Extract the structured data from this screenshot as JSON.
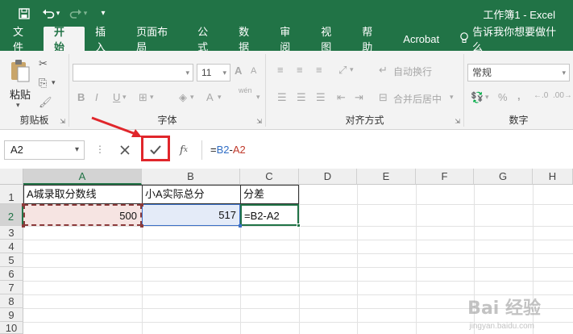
{
  "window": {
    "title": "工作簿1  -  Excel"
  },
  "qat": {
    "save_icon": "save-icon",
    "undo_icon": "undo-icon",
    "redo_icon": "redo-icon"
  },
  "tabs": [
    {
      "label": "文件"
    },
    {
      "label": "开始"
    },
    {
      "label": "插入"
    },
    {
      "label": "页面布局"
    },
    {
      "label": "公式"
    },
    {
      "label": "数据"
    },
    {
      "label": "审阅"
    },
    {
      "label": "视图"
    },
    {
      "label": "帮助"
    },
    {
      "label": "Acrobat"
    }
  ],
  "tell_me": "告诉我你想要做什么",
  "ribbon": {
    "clipboard": {
      "paste_label": "粘贴",
      "group_label": "剪贴板"
    },
    "font": {
      "font_size": "11",
      "group_label": "字体",
      "bold": "B",
      "italic": "I",
      "underline": "U",
      "font_color": "A",
      "size_up": "A",
      "size_down": "A",
      "wen": "wén"
    },
    "alignment": {
      "wrap_text": "自动换行",
      "merge_center": "合并后居中",
      "group_label": "对齐方式"
    },
    "number": {
      "format": "常规",
      "percent": "%",
      "comma": ",",
      "group_label": "数字"
    }
  },
  "formula_bar": {
    "name_box": "A2",
    "formula_ref1": "B2",
    "formula_op": "-",
    "formula_ref2": "A2",
    "formula_prefix": "="
  },
  "grid": {
    "columns": [
      "A",
      "B",
      "C",
      "D",
      "E",
      "F",
      "G",
      "H"
    ],
    "rows": [
      "1",
      "2",
      "3",
      "4",
      "5",
      "6",
      "7",
      "8",
      "9",
      "10"
    ],
    "cells": {
      "A1": "A城录取分数线",
      "B1": "小A实际总分",
      "C1": "分差",
      "A2": "500",
      "B2": "517",
      "C2": "=B2-A2"
    }
  },
  "watermark": {
    "brand": "Bai 经验",
    "url": "jingyan.baidu.com"
  }
}
